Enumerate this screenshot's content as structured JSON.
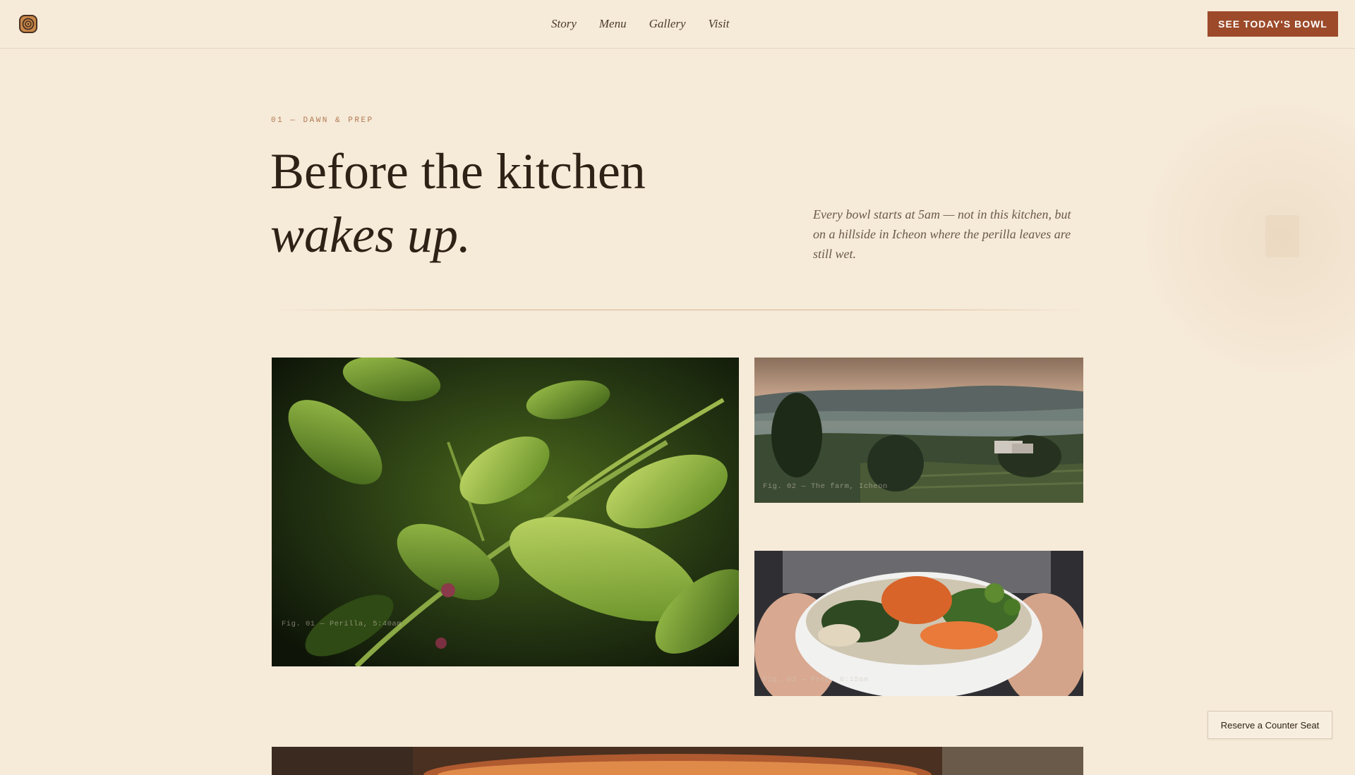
{
  "header": {
    "logo_icon": "bowl-swirl-icon",
    "nav": [
      {
        "label": "Story"
      },
      {
        "label": "Menu"
      },
      {
        "label": "Gallery"
      },
      {
        "label": "Visit"
      }
    ],
    "cta_label": "SEE TODAY'S BOWL"
  },
  "hero": {
    "eyebrow": "01 — DAWN & PREP",
    "headline_line1": "Before the kitchen",
    "headline_line2": "wakes up.",
    "intro": "Every bowl starts at 5am — not in this kitchen, but on a hillside in Icheon where the perilla leaves are still wet."
  },
  "gallery": {
    "fig1_caption": "Fig. 01 — Perilla, 5:40am",
    "fig2_caption": "Fig. 02 — The farm, Icheon",
    "fig3_caption": "Fig. 03 — Prep, 6:15am"
  },
  "floating": {
    "reserve_label": "Reserve a Counter Seat"
  },
  "colors": {
    "background": "#f6ead8",
    "accent": "#9c4a2a",
    "text": "#2e2116",
    "eyebrow": "#b07a55"
  }
}
